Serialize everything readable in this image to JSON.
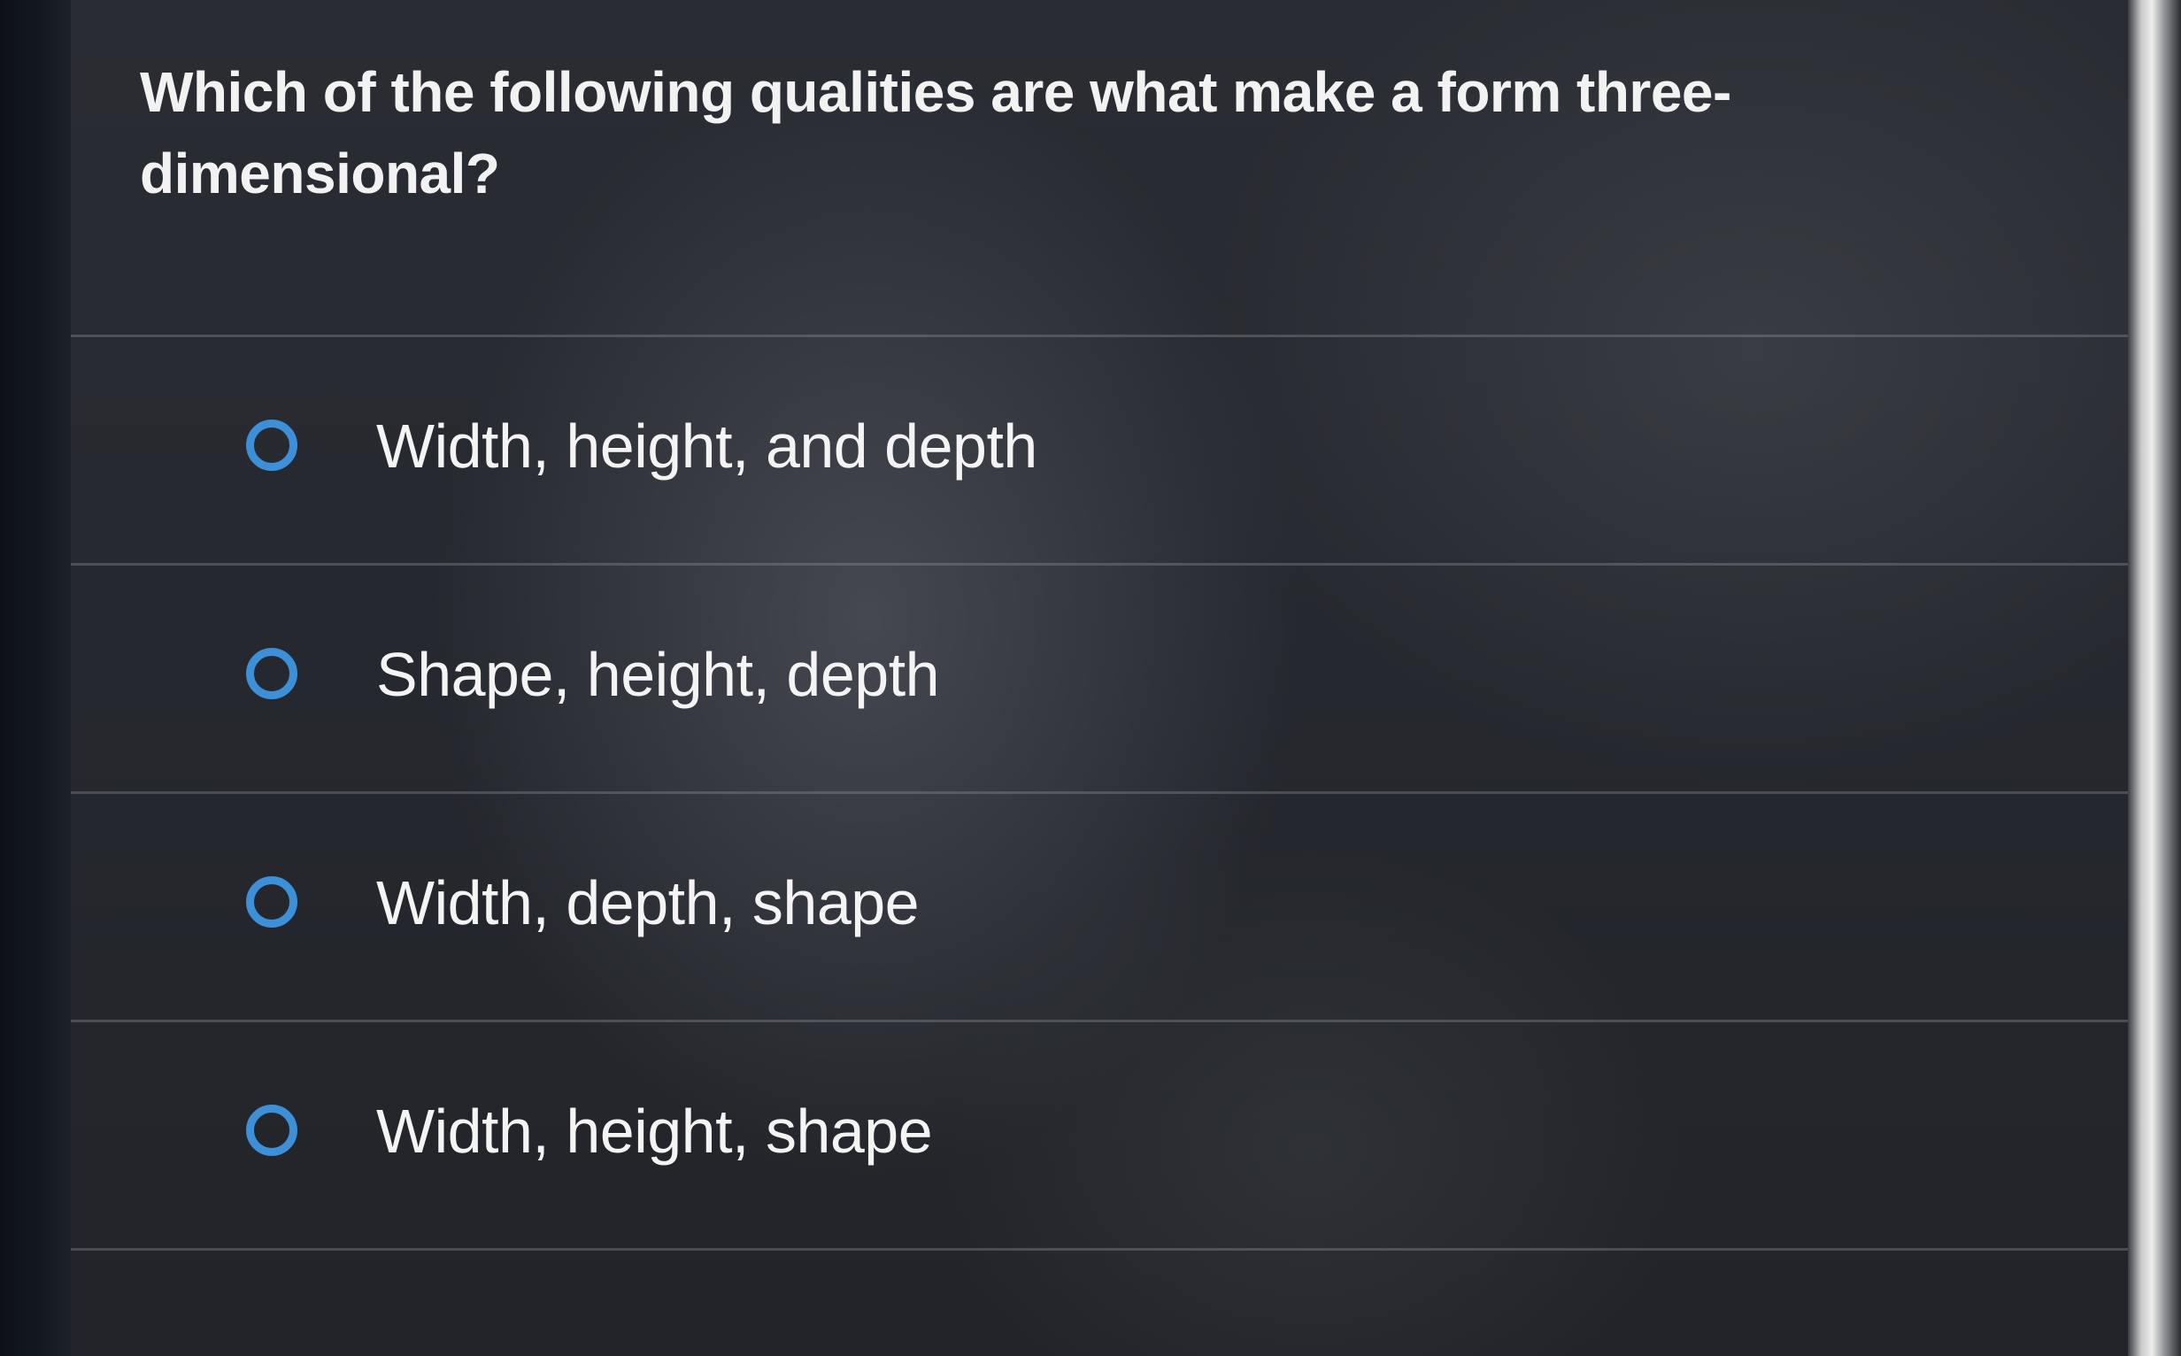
{
  "question": {
    "text": "Which of the following qualities are what make a form three-dimensional?"
  },
  "options": [
    {
      "label": "Width, height, and depth",
      "selected": false
    },
    {
      "label": "Shape, height, depth",
      "selected": false
    },
    {
      "label": "Width, depth, shape",
      "selected": false
    },
    {
      "label": "Width, height, shape",
      "selected": false
    }
  ],
  "colors": {
    "radio_accent": "#3d8fd8",
    "text": "#f2f2f2",
    "panel_background": "#26282f"
  }
}
